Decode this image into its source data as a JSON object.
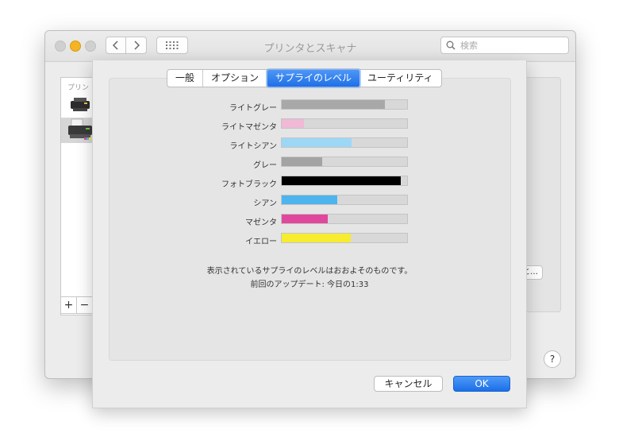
{
  "window": {
    "title": "プリンタとスキャナ",
    "search_placeholder": "検索",
    "sidebar_header": "プリン",
    "add_label": "+",
    "remove_label": "−",
    "options_button_label": "と…",
    "help_label": "?"
  },
  "tabs": [
    {
      "label": "一般",
      "active": false
    },
    {
      "label": "オプション",
      "active": false
    },
    {
      "label": "サプライのレベル",
      "active": true
    },
    {
      "label": "ユーティリティ",
      "active": false
    }
  ],
  "supplies": [
    {
      "name": "ライトグレー",
      "level": 0.82,
      "color": "#a8a8a8"
    },
    {
      "name": "ライトマゼンタ",
      "level": 0.18,
      "color": "#f0b9d6"
    },
    {
      "name": "ライトシアン",
      "level": 0.56,
      "color": "#9cd8f6"
    },
    {
      "name": "グレー",
      "level": 0.32,
      "color": "#a3a3a3"
    },
    {
      "name": "フォトブラック",
      "level": 0.95,
      "color": "#000000"
    },
    {
      "name": "シアン",
      "level": 0.44,
      "color": "#4db4ee"
    },
    {
      "name": "マゼンタ",
      "level": 0.37,
      "color": "#e0489c"
    },
    {
      "name": "イエロー",
      "level": 0.55,
      "color": "#f7ec2f"
    }
  ],
  "notes": {
    "approx": "表示されているサプライのレベルはおおよそのものです。",
    "updated": "前回のアップデート: 今日の1:33"
  },
  "buttons": {
    "cancel": "キャンセル",
    "ok": "OK"
  }
}
